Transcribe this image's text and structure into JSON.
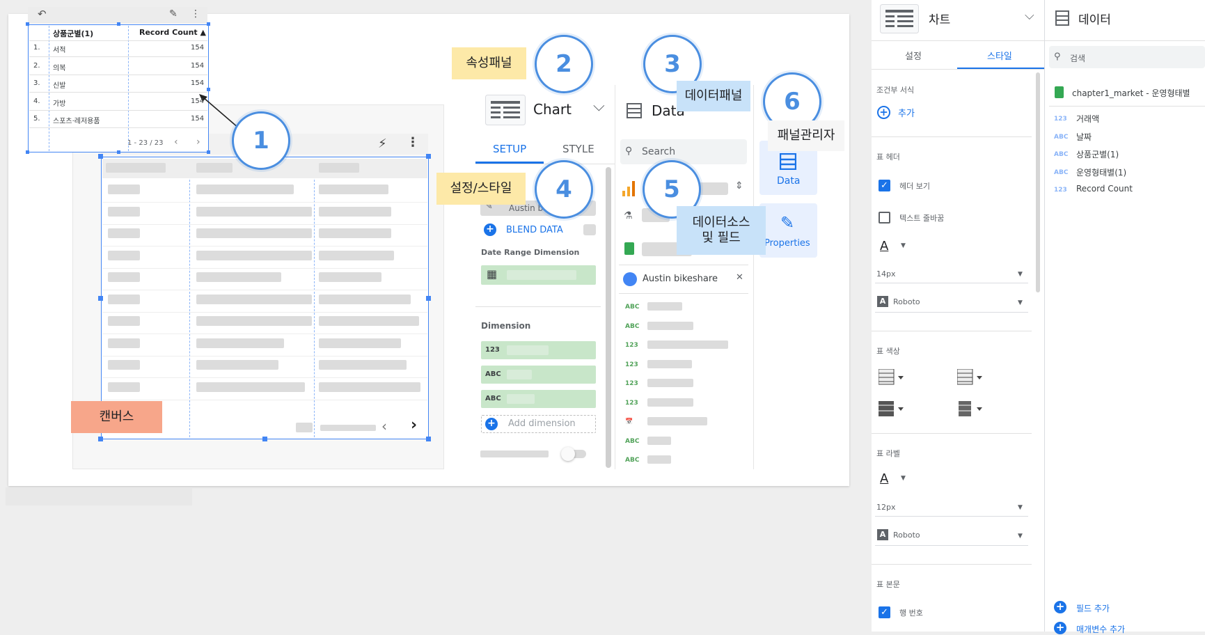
{
  "mini_table": {
    "headers": [
      "상품군별(1)",
      "Record Count ▲"
    ],
    "rows": [
      {
        "num": "1.",
        "name": "서적",
        "count": "154"
      },
      {
        "num": "2.",
        "name": "의복",
        "count": "154"
      },
      {
        "num": "3.",
        "name": "신발",
        "count": "154"
      },
      {
        "num": "4.",
        "name": "가방",
        "count": "154"
      },
      {
        "num": "5.",
        "name": "스포츠·레저용품",
        "count": "154"
      }
    ],
    "pagination": "1 - 23 / 23"
  },
  "callouts": {
    "c1": "1",
    "c2": "2",
    "c3": "3",
    "c4": "4",
    "c5": "5",
    "c6": "6",
    "property_panel": "속성패널",
    "data_panel": "데이터패널",
    "setup_style": "설정/스타일",
    "data_source_line1": "데이터소스",
    "data_source_line2": "및 필드",
    "panel_manager": "패널관리자",
    "canvas": "캔버스"
  },
  "en_panel": {
    "chart_title": "Chart",
    "data_title": "Data",
    "tab_setup": "SETUP",
    "tab_style": "STYLE",
    "source_value": "Austin b",
    "blend_data": "BLEND DATA",
    "date_range_label": "Date Range Dimension",
    "dimension_label": "Dimension",
    "add_dimension": "Add dimension",
    "search_placeholder": "Search",
    "datasource_name": "Austin bikeshare",
    "rail_data": "Data",
    "rail_properties": "Properties",
    "field_types": [
      "ABC",
      "ABC",
      "123",
      "123",
      "123",
      "123",
      "📅",
      "ABC",
      "ABC"
    ],
    "dim_types": [
      "123",
      "ABC",
      "ABC"
    ]
  },
  "props": {
    "title": "차트",
    "tab_setup": "설정",
    "tab_style": "스타일",
    "conditional_format": "조건부 서식",
    "add": "추가",
    "table_header": "표 헤더",
    "show_header": "헤더 보기",
    "wrap_text": "텍스트 줄바꿈",
    "header_font_size": "14px",
    "header_font_family": "Roboto",
    "table_colors": "표 색상",
    "table_labels": "표 라벨",
    "label_font_size": "12px",
    "label_font_family": "Roboto",
    "table_body": "표 본문",
    "row_numbers": "행 번호"
  },
  "data_panel": {
    "title": "데이터",
    "search_placeholder": "검색",
    "source": "chapter1_market - 운영형태별",
    "fields": [
      {
        "type": "123",
        "name": "거래액"
      },
      {
        "type": "ABC",
        "name": "날짜"
      },
      {
        "type": "ABC",
        "name": "상품군별(1)"
      },
      {
        "type": "ABC",
        "name": "운영형태별(1)"
      },
      {
        "type": "123",
        "name": "Record Count"
      }
    ],
    "add_field": "필드 추가",
    "add_parameter": "매개변수 추가"
  },
  "colors": {
    "accent": "#1a73e8",
    "selection": "#4285f4",
    "callout_ring": "#4a8ee0",
    "note_yellow": "#fde9a8",
    "note_blue": "#c8e2f9",
    "note_orange": "#f7a68a"
  }
}
